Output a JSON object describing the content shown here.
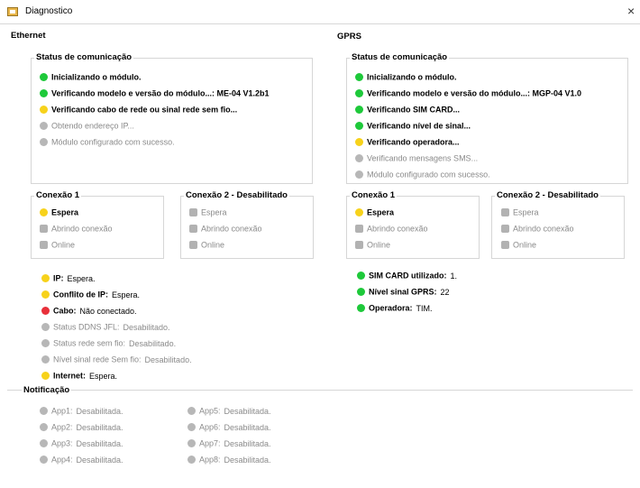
{
  "window": {
    "title": "Diagnostico",
    "close_label": "×"
  },
  "ethernet": {
    "label": "Ethernet",
    "status_label": "Status de comunicação",
    "status_items": [
      {
        "text": "Inicializando o módulo.",
        "color": "green",
        "bold": true
      },
      {
        "text": "Verificando modelo e versão do módulo...: ME-04 V1.2b1",
        "color": "green",
        "bold": true
      },
      {
        "text": "Verificando cabo de rede ou sinal rede sem fio...",
        "color": "yellow",
        "bold": true
      },
      {
        "text": "Obtendo endereço IP...",
        "color": "gray",
        "bold": false
      },
      {
        "text": "Módulo configurado com sucesso.",
        "color": "gray",
        "bold": false
      }
    ],
    "conn1": {
      "label": "Conexão 1",
      "items": [
        {
          "text": "Espera",
          "color": "yellow",
          "bold": true
        },
        {
          "text": "Abrindo conexão",
          "color": "gray",
          "bold": false
        },
        {
          "text": "Online",
          "color": "gray",
          "bold": false
        }
      ]
    },
    "conn2": {
      "label": "Conexão 2 - Desabilitado",
      "items": [
        {
          "text": "Espera"
        },
        {
          "text": "Abrindo conexão"
        },
        {
          "text": "Online"
        }
      ]
    },
    "info": [
      {
        "label": "IP:",
        "value": "Espera.",
        "color": "yellow",
        "active": true
      },
      {
        "label": "Conflito de IP:",
        "value": "Espera.",
        "color": "yellow",
        "active": true
      },
      {
        "label": "Cabo:",
        "value": "Não conectado.",
        "color": "red",
        "active": true
      },
      {
        "label": "Status DDNS JFL:",
        "value": "Desabilitado.",
        "color": "gray",
        "active": false
      },
      {
        "label": "Status rede sem fio:",
        "value": "Desabilitado.",
        "color": "gray",
        "active": false
      },
      {
        "label": "Nível sinal rede Sem fio:",
        "value": "Desabilitado.",
        "color": "gray",
        "active": false
      },
      {
        "label": "Internet:",
        "value": "Espera.",
        "color": "yellow",
        "active": true
      }
    ]
  },
  "gprs": {
    "label": "GPRS",
    "status_label": "Status de comunicação",
    "status_items": [
      {
        "text": "Inicializando o módulo.",
        "color": "green",
        "bold": true
      },
      {
        "text": "Verificando modelo e versão do módulo...: MGP-04 V1.0",
        "color": "green",
        "bold": true
      },
      {
        "text": "Verificando SIM CARD...",
        "color": "green",
        "bold": true
      },
      {
        "text": "Verificando nível de sinal...",
        "color": "green",
        "bold": true
      },
      {
        "text": "Verificando operadora...",
        "color": "yellow",
        "bold": true
      },
      {
        "text": "Verificando mensagens SMS...",
        "color": "gray",
        "bold": false
      },
      {
        "text": "Módulo configurado com sucesso.",
        "color": "gray",
        "bold": false
      }
    ],
    "conn1": {
      "label": "Conexão 1",
      "items": [
        {
          "text": "Espera",
          "color": "yellow",
          "bold": true
        },
        {
          "text": "Abrindo conexão",
          "color": "gray",
          "bold": false
        },
        {
          "text": "Online",
          "color": "gray",
          "bold": false
        }
      ]
    },
    "conn2": {
      "label": "Conexão 2 - Desabilitado",
      "items": [
        {
          "text": "Espera"
        },
        {
          "text": "Abrindo conexão"
        },
        {
          "text": "Online"
        }
      ]
    },
    "info": [
      {
        "label": "SIM CARD utilizado:",
        "value": "1.",
        "color": "green",
        "active": true
      },
      {
        "label": "Nível sinal GPRS:",
        "value": "22",
        "color": "green",
        "active": true
      },
      {
        "label": "Operadora:",
        "value": "TIM.",
        "color": "green",
        "active": true
      }
    ]
  },
  "notificacao": {
    "label": "Notificação",
    "apps": [
      {
        "label": "App1:",
        "value": "Desabilitada."
      },
      {
        "label": "App2:",
        "value": "Desabilitada."
      },
      {
        "label": "App3:",
        "value": "Desabilitada."
      },
      {
        "label": "App4:",
        "value": "Desabilitada."
      },
      {
        "label": "App5:",
        "value": "Desabilitada."
      },
      {
        "label": "App6:",
        "value": "Desabilitada."
      },
      {
        "label": "App7:",
        "value": "Desabilitada."
      },
      {
        "label": "App8:",
        "value": "Desabilitada."
      }
    ]
  },
  "colors": {
    "green": "#1ec93a",
    "yellow": "#f7d21b",
    "red": "#e8303a",
    "gray": "#b7b7b7"
  }
}
